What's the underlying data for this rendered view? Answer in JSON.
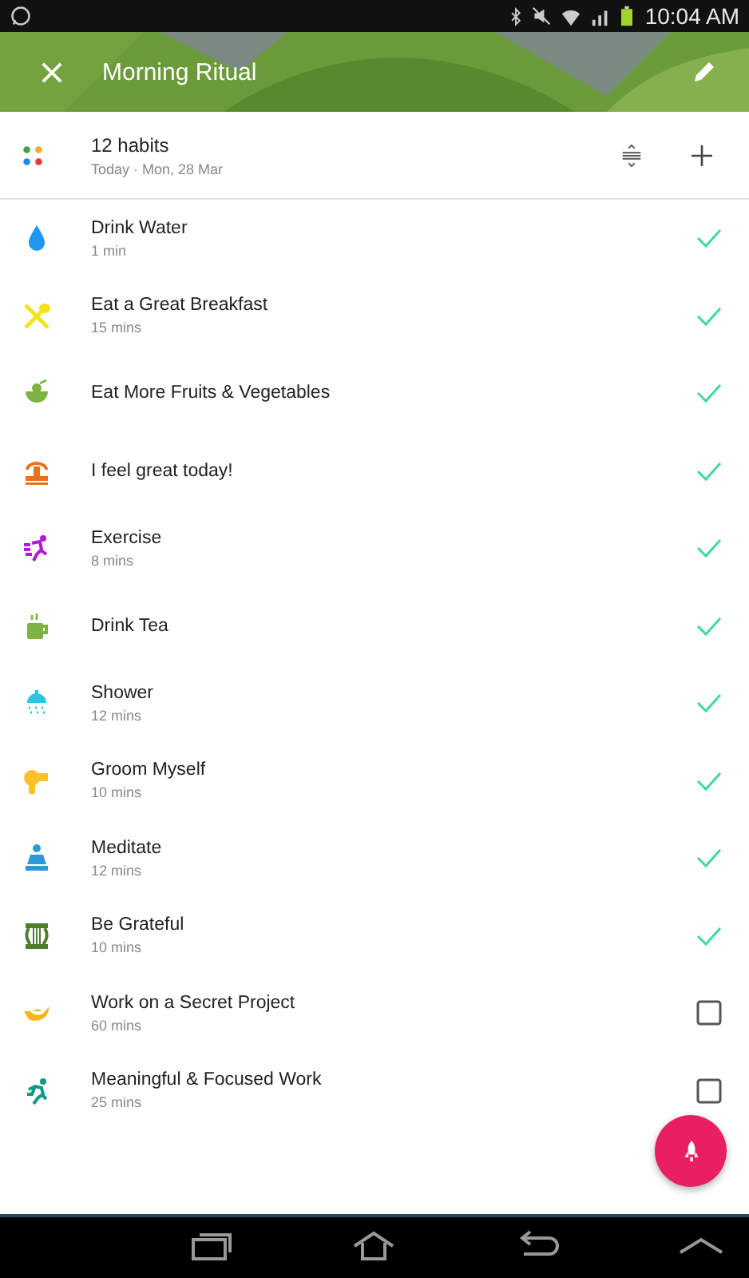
{
  "status_bar": {
    "time": "10:04 AM"
  },
  "toolbar": {
    "title": "Morning Ritual"
  },
  "summary": {
    "title": "12 habits",
    "subtitle": "Today · Mon, 28 Mar"
  },
  "habits": [
    {
      "name": "Drink Water",
      "duration": "1 min",
      "color": "#2196f3",
      "done": true
    },
    {
      "name": "Eat a Great Breakfast",
      "duration": "15 mins",
      "color": "#f5e11e",
      "done": true
    },
    {
      "name": "Eat More Fruits & Vegetables",
      "color": "#7cb342",
      "done": true
    },
    {
      "name": "I feel great today!",
      "color": "#e8711c",
      "done": true
    },
    {
      "name": "Exercise",
      "duration": "8 mins",
      "color": "#b21bd6",
      "done": true
    },
    {
      "name": "Drink Tea",
      "color": "#7cb342",
      "done": true
    },
    {
      "name": "Shower",
      "duration": "12 mins",
      "color": "#29c4e6",
      "done": true
    },
    {
      "name": "Groom Myself",
      "duration": "10 mins",
      "color": "#fbc02d",
      "done": true
    },
    {
      "name": "Meditate",
      "duration": "12 mins",
      "color": "#2c9ad6",
      "done": true
    },
    {
      "name": "Be Grateful",
      "duration": "10 mins",
      "color": "#4e7d2b",
      "done": true
    },
    {
      "name": "Work on a Secret Project",
      "duration": "60 mins",
      "color": "#f9b61c",
      "done": false
    },
    {
      "name": "Meaningful & Focused Work",
      "duration": "25 mins",
      "color": "#0f9a86",
      "done": false
    }
  ]
}
